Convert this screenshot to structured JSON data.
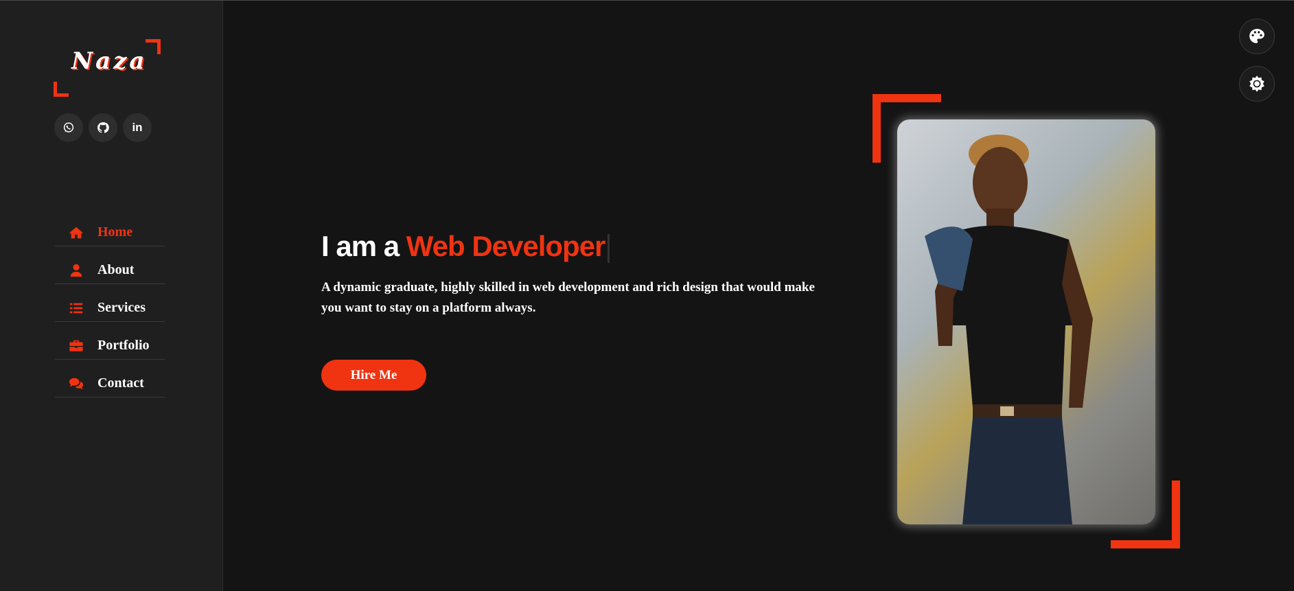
{
  "brand": {
    "logo_text": "Naza"
  },
  "socials": [
    {
      "icon": "whatsapp-icon"
    },
    {
      "icon": "github-icon"
    },
    {
      "icon": "linkedin-icon",
      "text": "in"
    }
  ],
  "nav": {
    "items": [
      {
        "label": "Home",
        "icon": "home-icon",
        "active": true
      },
      {
        "label": "About",
        "icon": "user-icon",
        "active": false
      },
      {
        "label": "Services",
        "icon": "list-icon",
        "active": false
      },
      {
        "label": "Portfolio",
        "icon": "briefcase-icon",
        "active": false
      },
      {
        "label": "Contact",
        "icon": "chat-icon",
        "active": false
      }
    ]
  },
  "hero": {
    "intro": "I am a",
    "role": "Web Developer",
    "description": "A dynamic graduate, highly skilled in web development and rich design that would make you want to stay on a platform always.",
    "cta": "Hire Me"
  },
  "controls": {
    "palette_icon": "palette-icon",
    "theme_icon": "gear-icon"
  },
  "colors": {
    "accent": "#f03311",
    "background": "#141414",
    "sidebar": "#1f1f1f"
  }
}
